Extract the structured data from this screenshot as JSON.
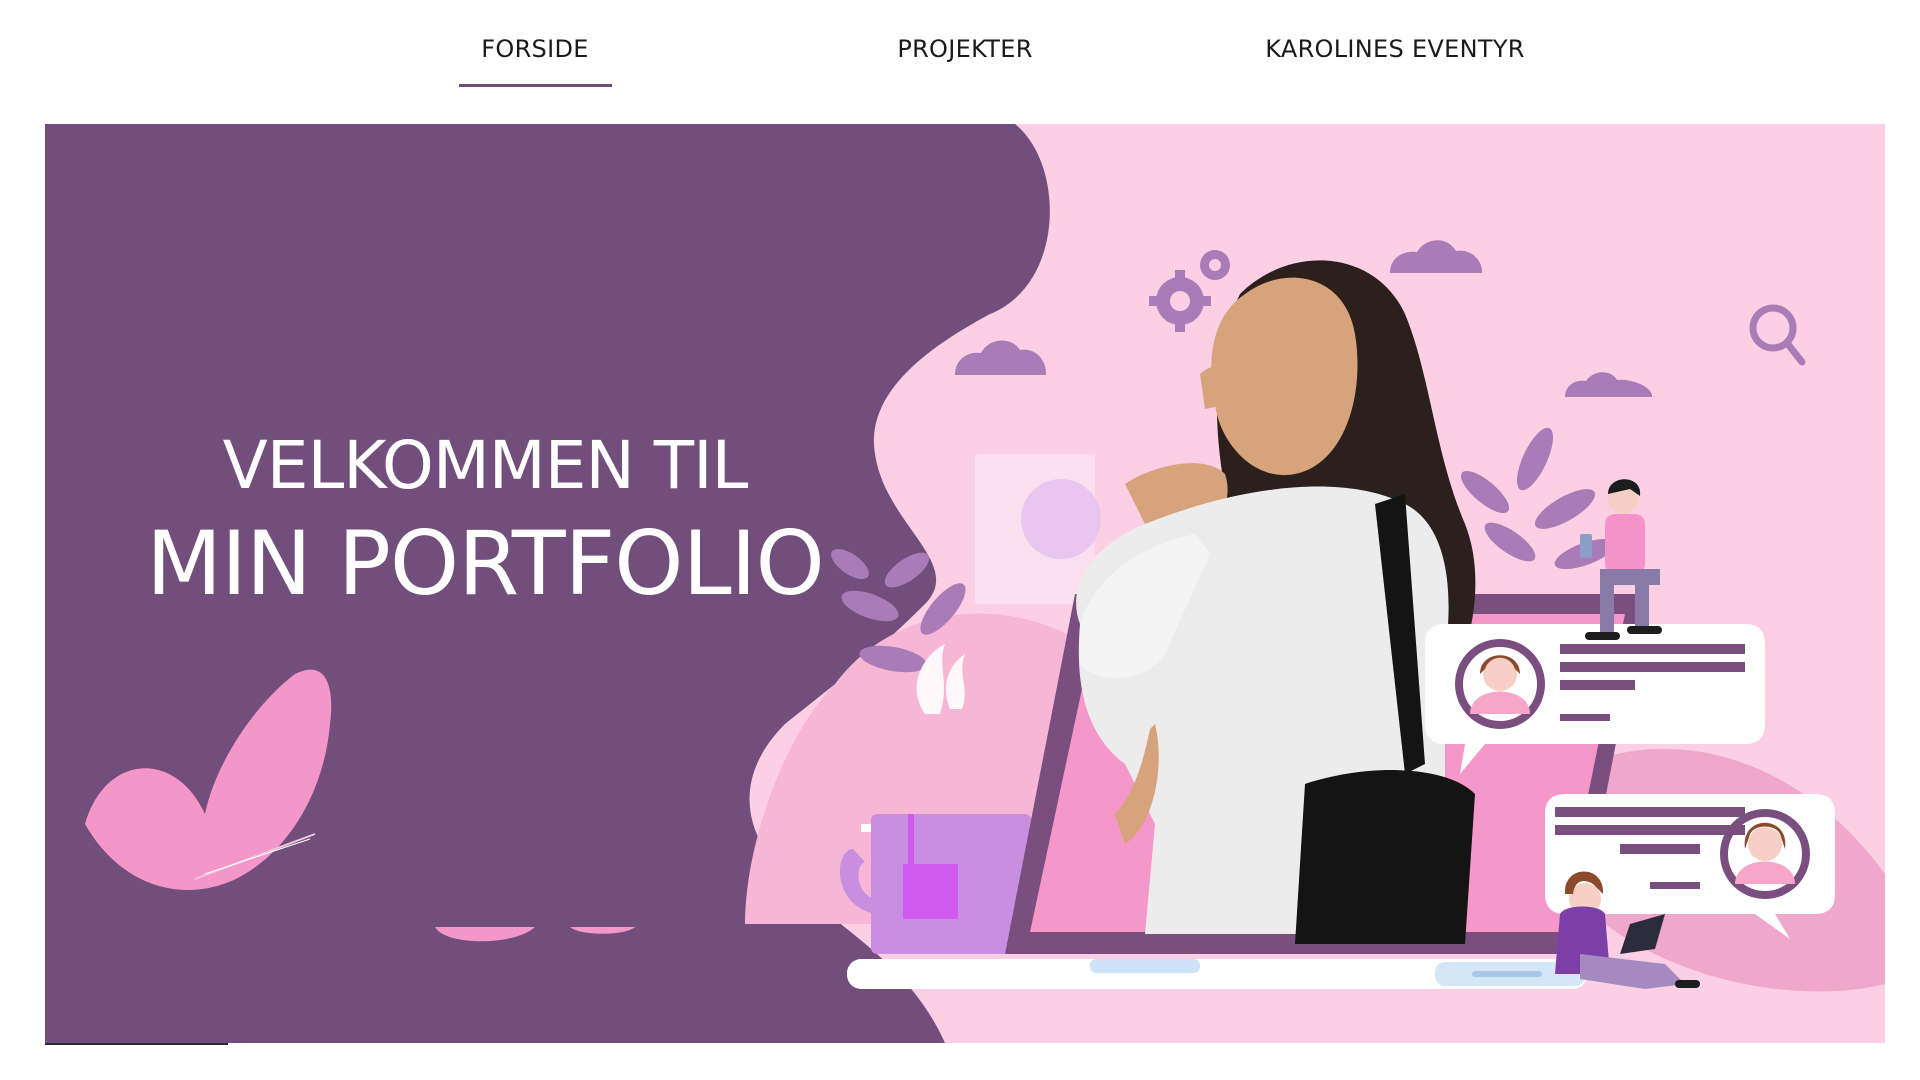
{
  "nav": {
    "items": [
      {
        "label": "FORSIDE",
        "active": true
      },
      {
        "label": "PROJEKTER",
        "active": false
      },
      {
        "label": "KAROLINES EVENTYR",
        "active": false
      }
    ],
    "active_underline_color": "#6e4c7a"
  },
  "hero": {
    "heading_line1": "VELKOMMEN TIL",
    "heading_line2": "MIN PORTFOLIO",
    "colors": {
      "purple_panel": "#714e7b",
      "pink_background": "#fdcfe5",
      "accent_pink": "#f492cb",
      "laptop_frame": "#7a4f80"
    }
  }
}
